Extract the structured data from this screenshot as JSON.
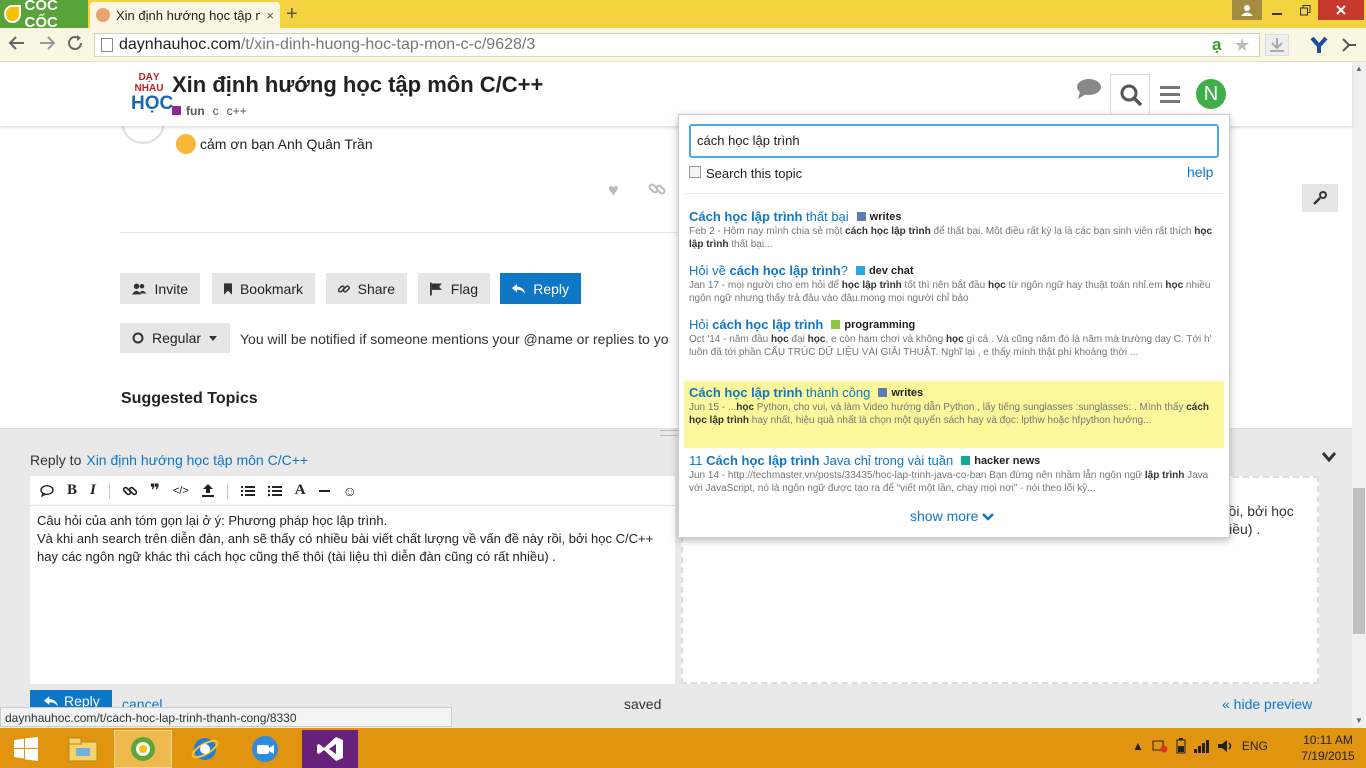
{
  "browser": {
    "brand": "CỐC CỐC",
    "tab_title": "Xin định hướng học tập m",
    "tab_close": "×",
    "new_tab": "+",
    "url_domain": "daynhauhoc.com",
    "url_path": "/t/xin-dinh-huong-hoc-tap-mon-c-c/9628/3"
  },
  "site": {
    "logo_line1": "DẠY",
    "logo_line2": "NHAU",
    "logo_line3": "HỌC",
    "avatar_letter": "N"
  },
  "topic": {
    "title": "Xin định hướng học tập môn C/C++",
    "category": "fun",
    "tag1": "c",
    "tag2": "c++",
    "category_color": "#92278f"
  },
  "post": {
    "text": "cảm ơn bạn Anh Quân Trần"
  },
  "actions": {
    "invite": "Invite",
    "bookmark": "Bookmark",
    "share": "Share",
    "flag": "Flag",
    "reply": "Reply",
    "regular": "Regular",
    "notification": "You will be notified if someone mentions your @name or replies to yo",
    "suggested": "Suggested Topics"
  },
  "composer": {
    "reply_to_label": "Reply to",
    "reply_to_topic": "Xin định hướng học tập môn C/C++",
    "body": "Câu hỏi của anh tóm gọn lại ở ý: Phương pháp học lập trình.\nVà khi anh search trên diễn đàn, anh sẽ thấy có nhiều bài viết chất lượng về vấn đề này rồi, bởi học C/C++\nhay các ngôn ngữ khác thì cách học cũng thế thôi (tài liệu thì diễn đàn cũng có rất nhiều) .",
    "preview_line1": "y rồi, bởi học",
    "preview_line2": "ất nhiều) .",
    "reply_button": "Reply",
    "cancel": "cancel",
    "saved": "saved",
    "hide_preview": "« hide preview"
  },
  "search": {
    "query": "cách học lập trình",
    "search_this_topic": "Search this topic",
    "help": "help",
    "show_more": "show more",
    "results": [
      {
        "title_pre": "",
        "title_hl": "Cách học lập trình",
        "title_post": " thất bại",
        "category": "writes",
        "color": "#5a7fb0",
        "blurb": "Feb 2 - Hôm nay mình chia sẻ một <b>cách học lập trình</b> để thất bại. Một điều rất kỳ lạ là các bạn sinh viên rất thích <b>học lập trình</b> thất bại..."
      },
      {
        "title_pre": "Hỏi về ",
        "title_hl": "cách học lập trình",
        "title_post": "?",
        "category": "dev chat",
        "color": "#25aae1",
        "blurb": "Jan 17 - mọi người cho em hỏi để <b>học lập trình</b> tốt thì nên bắt đầu <b>học</b> từ ngôn ngữ hay thuật toán nhỉ.em <b>học</b> nhiều ngôn ngữ nhưng thấy trả đâu vào đâu.mong mọi người chỉ bảo"
      },
      {
        "title_pre": "Hỏi ",
        "title_hl": "cách học lập trình",
        "title_post": "",
        "category": "programming",
        "color": "#8dc63f",
        "blurb": "Oct '14 - năm đầu <b>học</b> đại <b>học</b>, e còn ham chơi và không <b>học</b> gì cả . Và cũng năm đó là năm mà trường dạy C. Tới h' luôn đã tới phần CẤU TRÚC DỮ LIỆU VÀI GIẢI THUẬT. Nghĩ lại , e thấy mình thật phí khoảng thời ..."
      },
      {
        "title_pre": "",
        "title_hl": "Cách học lập trình",
        "title_post": " thành công",
        "category": "writes",
        "color": "#5a7fb0",
        "blurb": "Jun 15 - ...<b>học</b> Python, cho vui, và làm Video hướng dẫn Python , lấy tiếng sunglasses :sunglasses: . Mình thấy <b>cách học lập trình</b> hay nhất, hiệu quả nhất là chọn một quyển sách hay và đọc: lpthw hoặc hfpython hướng..."
      },
      {
        "title_pre": "11 ",
        "title_hl": "Cách học lập trình",
        "title_post": " Java chỉ trong vài tuần",
        "category": "hacker news",
        "color": "#12a89d",
        "blurb": "Jun 14 - http://techmaster.vn/posts/33435/hoc-lap-trinh-java-co-ban Bạn đừng nên nhầm lẫn ngôn ngữ <b>lập trình</b> Java với JavaScript, nó là ngôn ngữ được tạo ra để “viết một lần, chạy mọi nơi” - nói theo lối kỹ..."
      }
    ]
  },
  "status_url": "daynhauhoc.com/t/cach-hoc-lap-trinh-thanh-cong/8330",
  "tray": {
    "lang": "ENG",
    "time": "10:11 AM",
    "date": "7/19/2015"
  }
}
